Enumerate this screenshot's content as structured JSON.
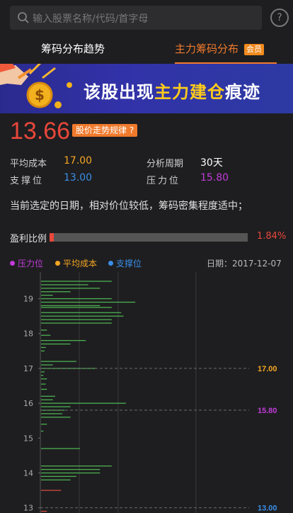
{
  "search": {
    "placeholder": "输入股票名称/代码/首字母",
    "icon": "search-icon"
  },
  "help": {
    "label": "?"
  },
  "tabs": [
    {
      "label": "筹码分布趋势"
    },
    {
      "label": "主力筹码分布"
    }
  ],
  "vip_badge": "会员",
  "banner": {
    "text_prefix": "该股出现",
    "text_highlight": "主力建仓",
    "text_suffix": "痕迹"
  },
  "price": "13.66",
  "trend_button": "股价走势规律 ?",
  "stats": {
    "avg_cost_label": "平均成本",
    "avg_cost_value": "17.00",
    "period_label": "分析周期",
    "period_value": "30天",
    "support_label": "支撑位",
    "support_value": "13.00",
    "pressure_label": "压力位",
    "pressure_value": "15.80"
  },
  "description": "当前选定的日期，相对价位较低，筹码密集程度适中；",
  "profit": {
    "label": "盈利比例",
    "value": "1.84%",
    "ratio": 0.0184
  },
  "legend": [
    {
      "label": "压力位",
      "color": "#c03bd8"
    },
    {
      "label": "平均成本",
      "color": "#f5a623"
    },
    {
      "label": "支撑位",
      "color": "#3a8ee6"
    }
  ],
  "date_label": "日期：",
  "date_value": "2017-12-07",
  "colors": {
    "accent": "#f07a2c",
    "price": "#e8473b",
    "avg": "#f5a623",
    "support": "#3a8ee6",
    "pressure": "#c03bd8",
    "bar_green": "#4caf50",
    "bar_red": "#d24a3f"
  },
  "chart_data": {
    "type": "bar",
    "orientation": "horizontal",
    "y_ticks": [
      "19",
      "18",
      "17",
      "16",
      "15",
      "14",
      "13"
    ],
    "ylim": [
      12.85,
      19.6
    ],
    "grid": true,
    "lines": [
      {
        "name": "平均成本",
        "price": 17.0,
        "label": "17.00"
      },
      {
        "name": "压力位",
        "price": 15.8,
        "label": "15.80"
      },
      {
        "name": "支撑位",
        "price": 13.0,
        "label": "13.00"
      }
    ],
    "bars": [
      [
        19.5,
        0.6
      ],
      [
        19.4,
        0.4
      ],
      [
        19.3,
        0.5
      ],
      [
        19.2,
        0.25
      ],
      [
        19.1,
        0.1
      ],
      [
        19.0,
        0.6
      ],
      [
        18.9,
        0.8
      ],
      [
        18.8,
        0.5
      ],
      [
        18.75,
        0.6
      ],
      [
        18.6,
        0.68
      ],
      [
        18.5,
        0.7
      ],
      [
        18.4,
        0.6
      ],
      [
        18.3,
        0.6
      ],
      [
        18.1,
        0.05
      ],
      [
        17.95,
        0.08
      ],
      [
        17.8,
        0.38
      ],
      [
        17.7,
        0.25
      ],
      [
        17.6,
        0.04
      ],
      [
        17.5,
        0.03
      ],
      [
        17.2,
        0.3
      ],
      [
        17.1,
        0.1
      ],
      [
        17.0,
        0.46
      ],
      [
        16.9,
        0.03
      ],
      [
        16.8,
        0.02
      ],
      [
        16.7,
        0.05
      ],
      [
        16.55,
        0.04
      ],
      [
        16.4,
        0.05
      ],
      [
        16.2,
        0.12
      ],
      [
        16.1,
        0.1
      ],
      [
        16.0,
        0.72
      ],
      [
        15.9,
        0.25
      ],
      [
        15.8,
        0.2
      ],
      [
        15.7,
        0.18
      ],
      [
        15.6,
        0.25
      ],
      [
        15.4,
        0.05
      ],
      [
        15.2,
        0.02
      ],
      [
        14.7,
        0.33
      ],
      [
        14.2,
        0.6
      ],
      [
        14.1,
        0.5
      ],
      [
        14.0,
        0.5
      ],
      [
        13.9,
        0.3
      ],
      [
        13.8,
        0.25
      ],
      [
        13.5,
        0.17
      ],
      [
        12.9,
        0.05
      ]
    ],
    "red_price_max": 13.66
  }
}
